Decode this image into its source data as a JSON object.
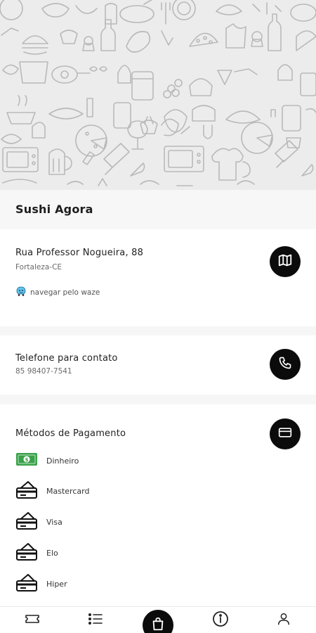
{
  "restaurant": {
    "name": "Sushi Agora"
  },
  "address": {
    "street": "Rua Professor Nogueira, 88",
    "city": "Fortaleza-CE",
    "waze_label": "navegar pelo waze",
    "map_icon": "map-icon"
  },
  "contact": {
    "label": "Telefone para contato",
    "phone": "85 98407-7541",
    "phone_icon": "phone-icon"
  },
  "payment": {
    "title": "Métodos de Pagamento",
    "icon": "credit-card-icon",
    "methods": [
      {
        "label": "Dinheiro",
        "icon": "cash-icon"
      },
      {
        "label": "Mastercard",
        "icon": "card-icon"
      },
      {
        "label": "Visa",
        "icon": "card-icon"
      },
      {
        "label": "Elo",
        "icon": "card-icon"
      },
      {
        "label": "Hiper",
        "icon": "card-icon"
      }
    ]
  },
  "bottom_nav": {
    "items": [
      {
        "icon": "ticket-icon"
      },
      {
        "icon": "list-icon"
      },
      {
        "icon": "shopping-bag-icon"
      },
      {
        "icon": "info-icon"
      },
      {
        "icon": "user-icon"
      }
    ]
  },
  "colors": {
    "accent": "#0b0b0b",
    "cash_green": "#3aa14a",
    "waze_blue": "#5ec4ef"
  }
}
